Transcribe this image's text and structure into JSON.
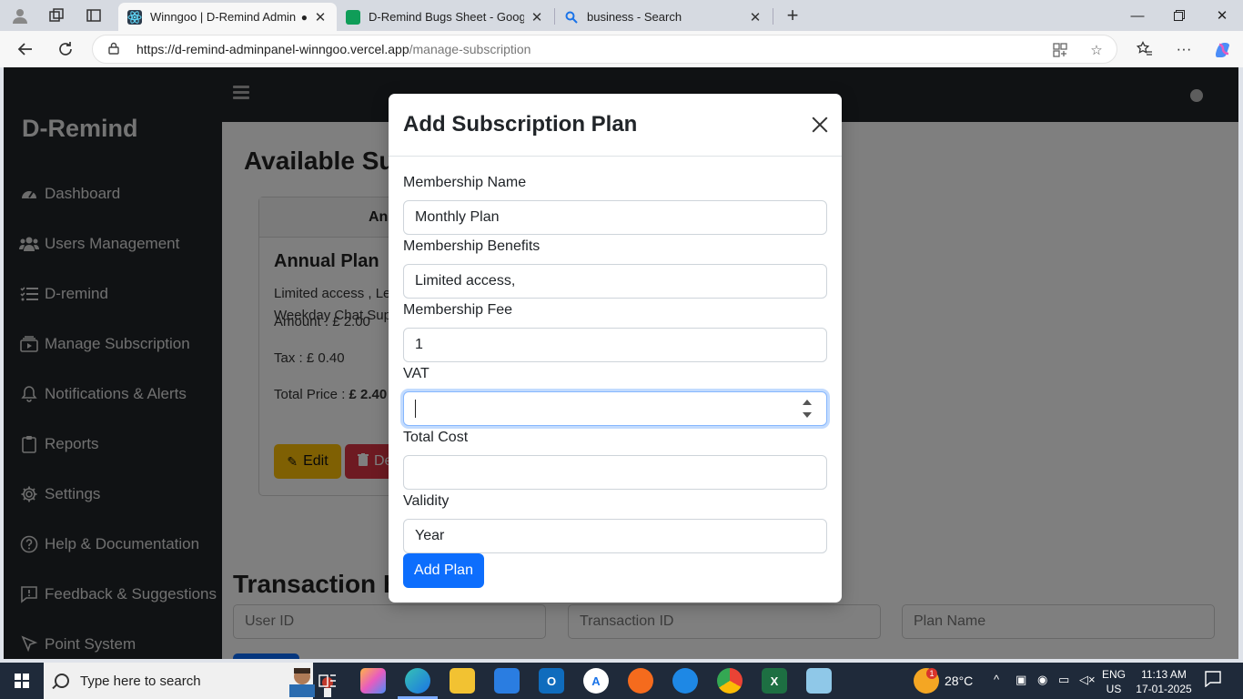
{
  "browser": {
    "tabs": [
      {
        "title": "Winngoo | D-Remind Admin",
        "favicon_color": "#3a7bd5",
        "active": true
      },
      {
        "title": "D-Remind Bugs Sheet - Google Sh",
        "favicon_color": "#0f9d58",
        "active": false
      },
      {
        "title": "business - Search",
        "favicon_color": "#1a73e8",
        "active": false
      }
    ],
    "url_host": "https://d-remind-adminpanel-winngoo.vercel.app",
    "url_path": "/manage-subscription"
  },
  "sidebar": {
    "brand": "D-Remind",
    "items": [
      {
        "label": "Dashboard",
        "icon": "gauge-icon"
      },
      {
        "label": "Users Management",
        "icon": "users-icon"
      },
      {
        "label": "D-remind",
        "icon": "list-icon"
      },
      {
        "label": "Manage Subscription",
        "icon": "subscription-icon"
      },
      {
        "label": "Notifications & Alerts",
        "icon": "bell-icon"
      },
      {
        "label": "Reports",
        "icon": "clipboard-icon"
      },
      {
        "label": "Settings",
        "icon": "gear-icon"
      },
      {
        "label": "Help & Documentation",
        "icon": "help-icon"
      },
      {
        "label": "Feedback & Suggestions",
        "icon": "feedback-icon"
      },
      {
        "label": "Point System",
        "icon": "pointer-icon"
      }
    ]
  },
  "main": {
    "section_title": "Available Sub",
    "card": {
      "header": "An",
      "title": "Annual Plan",
      "benefits": "Limited access , Le Weekday Chat Sup",
      "amount": "Amount : £ 2.00",
      "tax": "Tax : £ 0.40",
      "total_label": "Total Price : ",
      "total_value": "£ 2.40",
      "edit_label": "Edit",
      "delete_label": "De"
    },
    "transaction_title": "Transaction H",
    "filters": {
      "user_id": "User ID",
      "transaction_id": "Transaction ID",
      "plan_name": "Plan Name"
    }
  },
  "modal": {
    "title": "Add Subscription Plan",
    "fields": {
      "name_label": "Membership Name",
      "name_value": "Monthly Plan",
      "benefits_label": "Membership Benefits",
      "benefits_value": "Limited access,",
      "fee_label": "Membership Fee",
      "fee_value": "1",
      "vat_label": "VAT",
      "vat_value": "",
      "total_label": "Total Cost",
      "total_value": "",
      "validity_label": "Validity",
      "validity_value": "Year"
    },
    "submit_label": "Add Plan"
  },
  "taskbar": {
    "search_placeholder": "Type here to search",
    "weather_temp": "28°C",
    "lang": "ENG",
    "region": "US",
    "time": "11:13 AM",
    "date": "17-01-2025",
    "weather_badge": "1"
  },
  "colors": {
    "sidebar_bg": "#212529",
    "primary": "#0d6efd",
    "warning": "#ffc107",
    "danger": "#dc3545"
  }
}
